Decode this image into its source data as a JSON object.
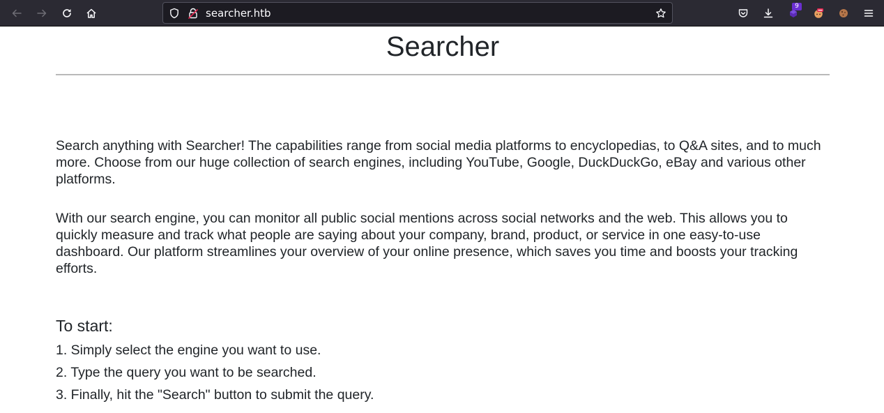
{
  "browser": {
    "url": "searcher.htb",
    "extension_badge_count": "9"
  },
  "page": {
    "title": "Searcher",
    "paragraphs": [
      "Search anything with Searcher! The capabilities range from social media platforms to encyclopedias, to Q&A sites, and to much more. Choose from our huge collection of search engines, including YouTube, Google, DuckDuckGo, eBay and various other platforms.",
      "With our search engine, you can monitor all public social mentions across social networks and the web. This allows you to quickly measure and track what people are saying about your company, brand, product, or service in one easy-to-use dashboard. Our platform streamlines your overview of your online presence, which saves you time and boosts your tracking efforts."
    ],
    "start_heading": "To start:",
    "steps": [
      "1. Simply select the engine you want to use.",
      "2. Type the query you want to be searched.",
      "3. Finally, hit the \"Search\" button to submit the query."
    ]
  },
  "icons": {
    "back": "back-arrow-icon",
    "forward": "forward-arrow-icon",
    "reload": "reload-icon",
    "home": "home-icon",
    "tracking": "shield-icon",
    "insecure": "insecure-lock-icon",
    "bookmark": "star-icon",
    "pocket": "pocket-icon",
    "downloads": "download-icon",
    "menu": "hamburger-menu-icon"
  },
  "colors": {
    "toolbar_bg": "#2b2a33",
    "urlbar_bg": "#1c1b22",
    "text": "#212529",
    "rule": "#b9b9b9",
    "insecure_red": "#e22850",
    "badge_purple": "#6b2fd1"
  }
}
